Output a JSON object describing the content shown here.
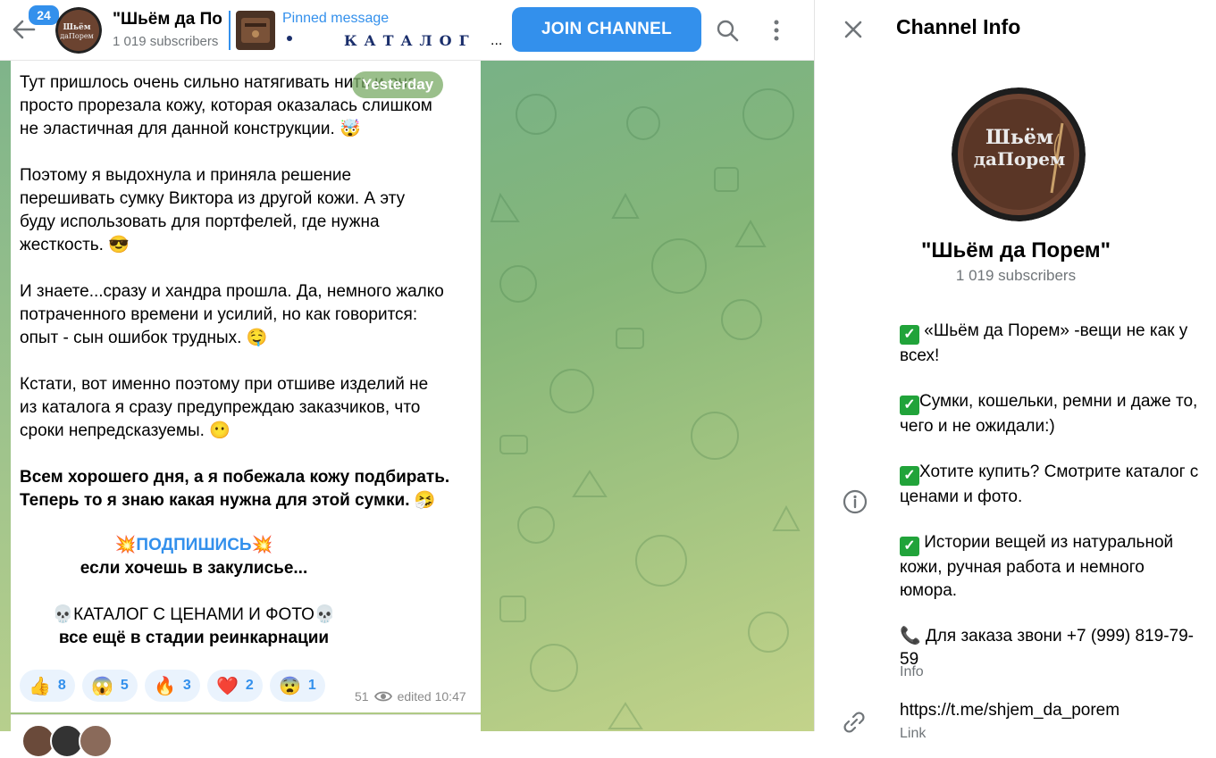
{
  "header": {
    "back_badge": "24",
    "channel_title": "\"Шьём да Порем\"",
    "subscribers_short": "1 019 subscribers",
    "pinned_label": "Pinned message",
    "pinned_text": "КАТАЛОГ",
    "pinned_ellipsis": "...",
    "join_label": "JOIN CHANNEL"
  },
  "chat": {
    "date_pill": "Yesterday",
    "paragraphs": [
      [
        "Тут пришлось очень сильно натягивать нить и она",
        "просто прорезала кожу, которая оказалась слишком",
        "не эластичная для данной конструкции. 🤯"
      ],
      [
        "Поэтому я выдохнула и приняла решение",
        "перешивать сумку Виктора из другой кожи. А эту",
        "буду использовать для портфелей, где нужна",
        "жесткость. 😎"
      ],
      [
        "И знаете...сразу и хандра прошла. Да, немного жалко",
        "потраченного времени и усилий, но как говорится:",
        "опыт - сын ошибок трудных. 🤤"
      ],
      [
        "Кстати, вот именно поэтому при отшиве изделий не",
        "из каталога я сразу предупреждаю заказчиков, что",
        "сроки непредсказуемы. 😶"
      ]
    ],
    "bold_lines": [
      "Всем хорошего дня, а я побежала кожу подбирать.",
      "Теперь то я знаю какая нужна для этой сумки. 🤧"
    ],
    "subscribe_link": "ПОДПИШИСЬ",
    "subscribe_emoji": "💥",
    "subscribe_sub": "если хочешь в закулисье...",
    "catalog_line": "КАТАЛОГ С ЦЕНАМИ И ФОТО",
    "catalog_emoji": "💀",
    "catalog_sub": "все ещё в стадии реинкарнации",
    "reactions": [
      {
        "emoji": "👍",
        "count": "8"
      },
      {
        "emoji": "😱",
        "count": "5"
      },
      {
        "emoji": "🔥",
        "count": "3"
      },
      {
        "emoji": "❤️",
        "count": "2"
      },
      {
        "emoji": "😨",
        "count": "1"
      }
    ],
    "views": "51",
    "edited": "edited 10:47"
  },
  "panel": {
    "title": "Channel Info",
    "avatar_text_1": "Шьём",
    "avatar_text_2": "даПорем",
    "channel_name": "\"Шьём да Порем\"",
    "subscribers": "1 019 subscribers",
    "desc": [
      "«Шьём да Порем» -вещи не как у всех!",
      "Сумки, кошельки, ремни и даже то, чего и не ожидали:)",
      "Хотите купить? Смотрите каталог с ценами и фото.",
      " Истории вещей из натуральной кожи, ручная работа и немного юмора."
    ],
    "phone_line": "📞 Для заказа звони +7 (999) 819-79-59",
    "info_label": "Info",
    "link": "https://t.me/shjem_da_porem",
    "link_label": "Link"
  },
  "colors": {
    "accent": "#3390ec",
    "check_green": "#21a33a",
    "leather": "#5a3a2a"
  },
  "icons": [
    "back-arrow-icon",
    "search-icon",
    "more-vertical-icon",
    "close-icon",
    "info-icon",
    "link-icon",
    "eye-icon"
  ]
}
